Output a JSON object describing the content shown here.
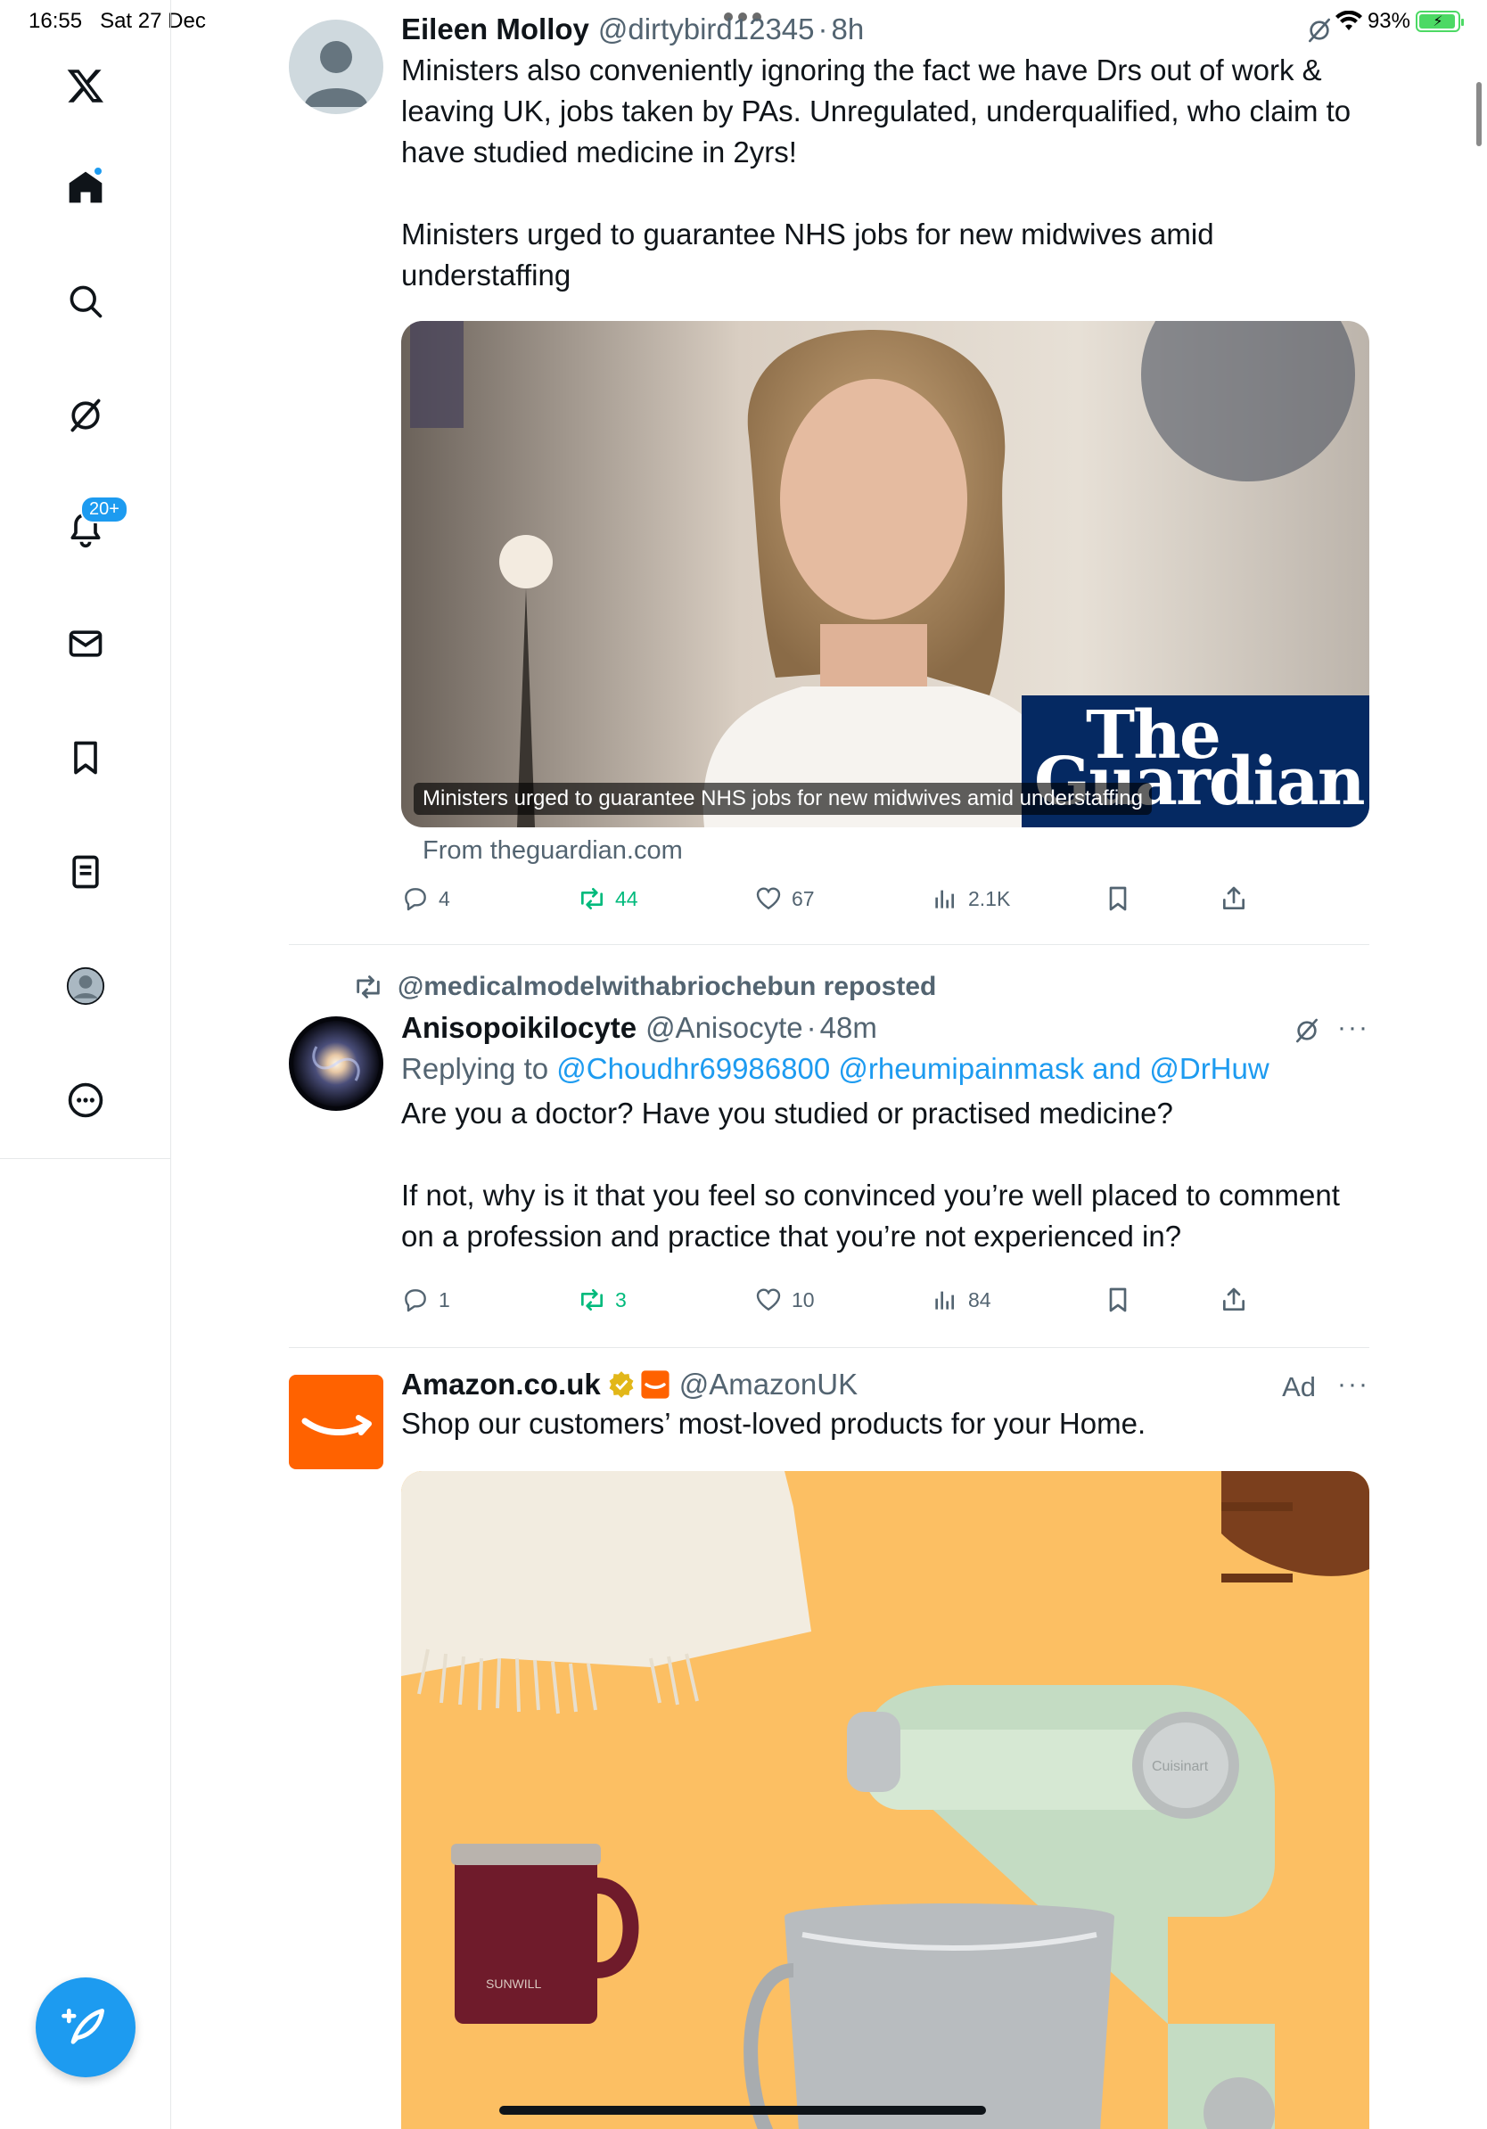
{
  "status_bar": {
    "time": "16:55",
    "date": "Sat 27 Dec",
    "battery": "93%"
  },
  "sidebar": {
    "items": [
      {
        "name": "x-logo-icon"
      },
      {
        "name": "home-icon"
      },
      {
        "name": "search-icon"
      },
      {
        "name": "grok-icon"
      },
      {
        "name": "notifications-icon",
        "badge": "20+"
      },
      {
        "name": "messages-icon"
      },
      {
        "name": "bookmarks-icon"
      },
      {
        "name": "lists-icon"
      },
      {
        "name": "profile-icon"
      },
      {
        "name": "more-icon"
      }
    ]
  },
  "posts": [
    {
      "name": "Eileen Molloy",
      "handle": "@dirtybird12345",
      "time": "8h",
      "text_1": "Ministers also conveniently ignoring the fact we have Drs out of work & leaving UK, jobs taken by PAs. Unregulated, underqualified, who claim to have studied medicine in 2yrs!",
      "text_2": "Ministers urged to guarantee NHS jobs for new midwives amid understaffing",
      "card": {
        "caption": "Ministers urged to guarantee NHS jobs for new midwives amid understaffing",
        "logo_line1": "The",
        "logo_line2": "Guardian",
        "source": "From theguardian.com"
      },
      "stats": {
        "replies": "4",
        "reposts": "44",
        "likes": "67",
        "views": "2.1K"
      }
    },
    {
      "reposted_by": "@medicalmodelwithabriochebun reposted",
      "name": "Anisopoikilocyte",
      "handle": "@Anisocyte",
      "time": "48m",
      "reply_prefix": "Replying to",
      "reply_to": "@Choudhr69986800 @rheumipainmask and @DrHuw",
      "text_1": "Are you a doctor? Have you studied or practised medicine?",
      "text_2": "If not, why is it that you feel so convinced you’re well placed to comment on a profession and practice that you’re not experienced in?",
      "stats": {
        "replies": "1",
        "reposts": "3",
        "likes": "10",
        "views": "84"
      }
    },
    {
      "name": "Amazon.co.uk",
      "handle": "@AmazonUK",
      "ad_label": "Ad",
      "text_1": "Shop our customers’ most-loved products for your Home.",
      "mug_brand": "SUNWILL",
      "mixer_brand": "Cuisinart"
    }
  ],
  "colors": {
    "accent": "#1d9bf0",
    "repost_green": "#00ba7c",
    "text_primary": "#0f1419",
    "text_secondary": "#536471",
    "amazon_orange": "#ff6200",
    "guardian_blue": "#052962"
  }
}
